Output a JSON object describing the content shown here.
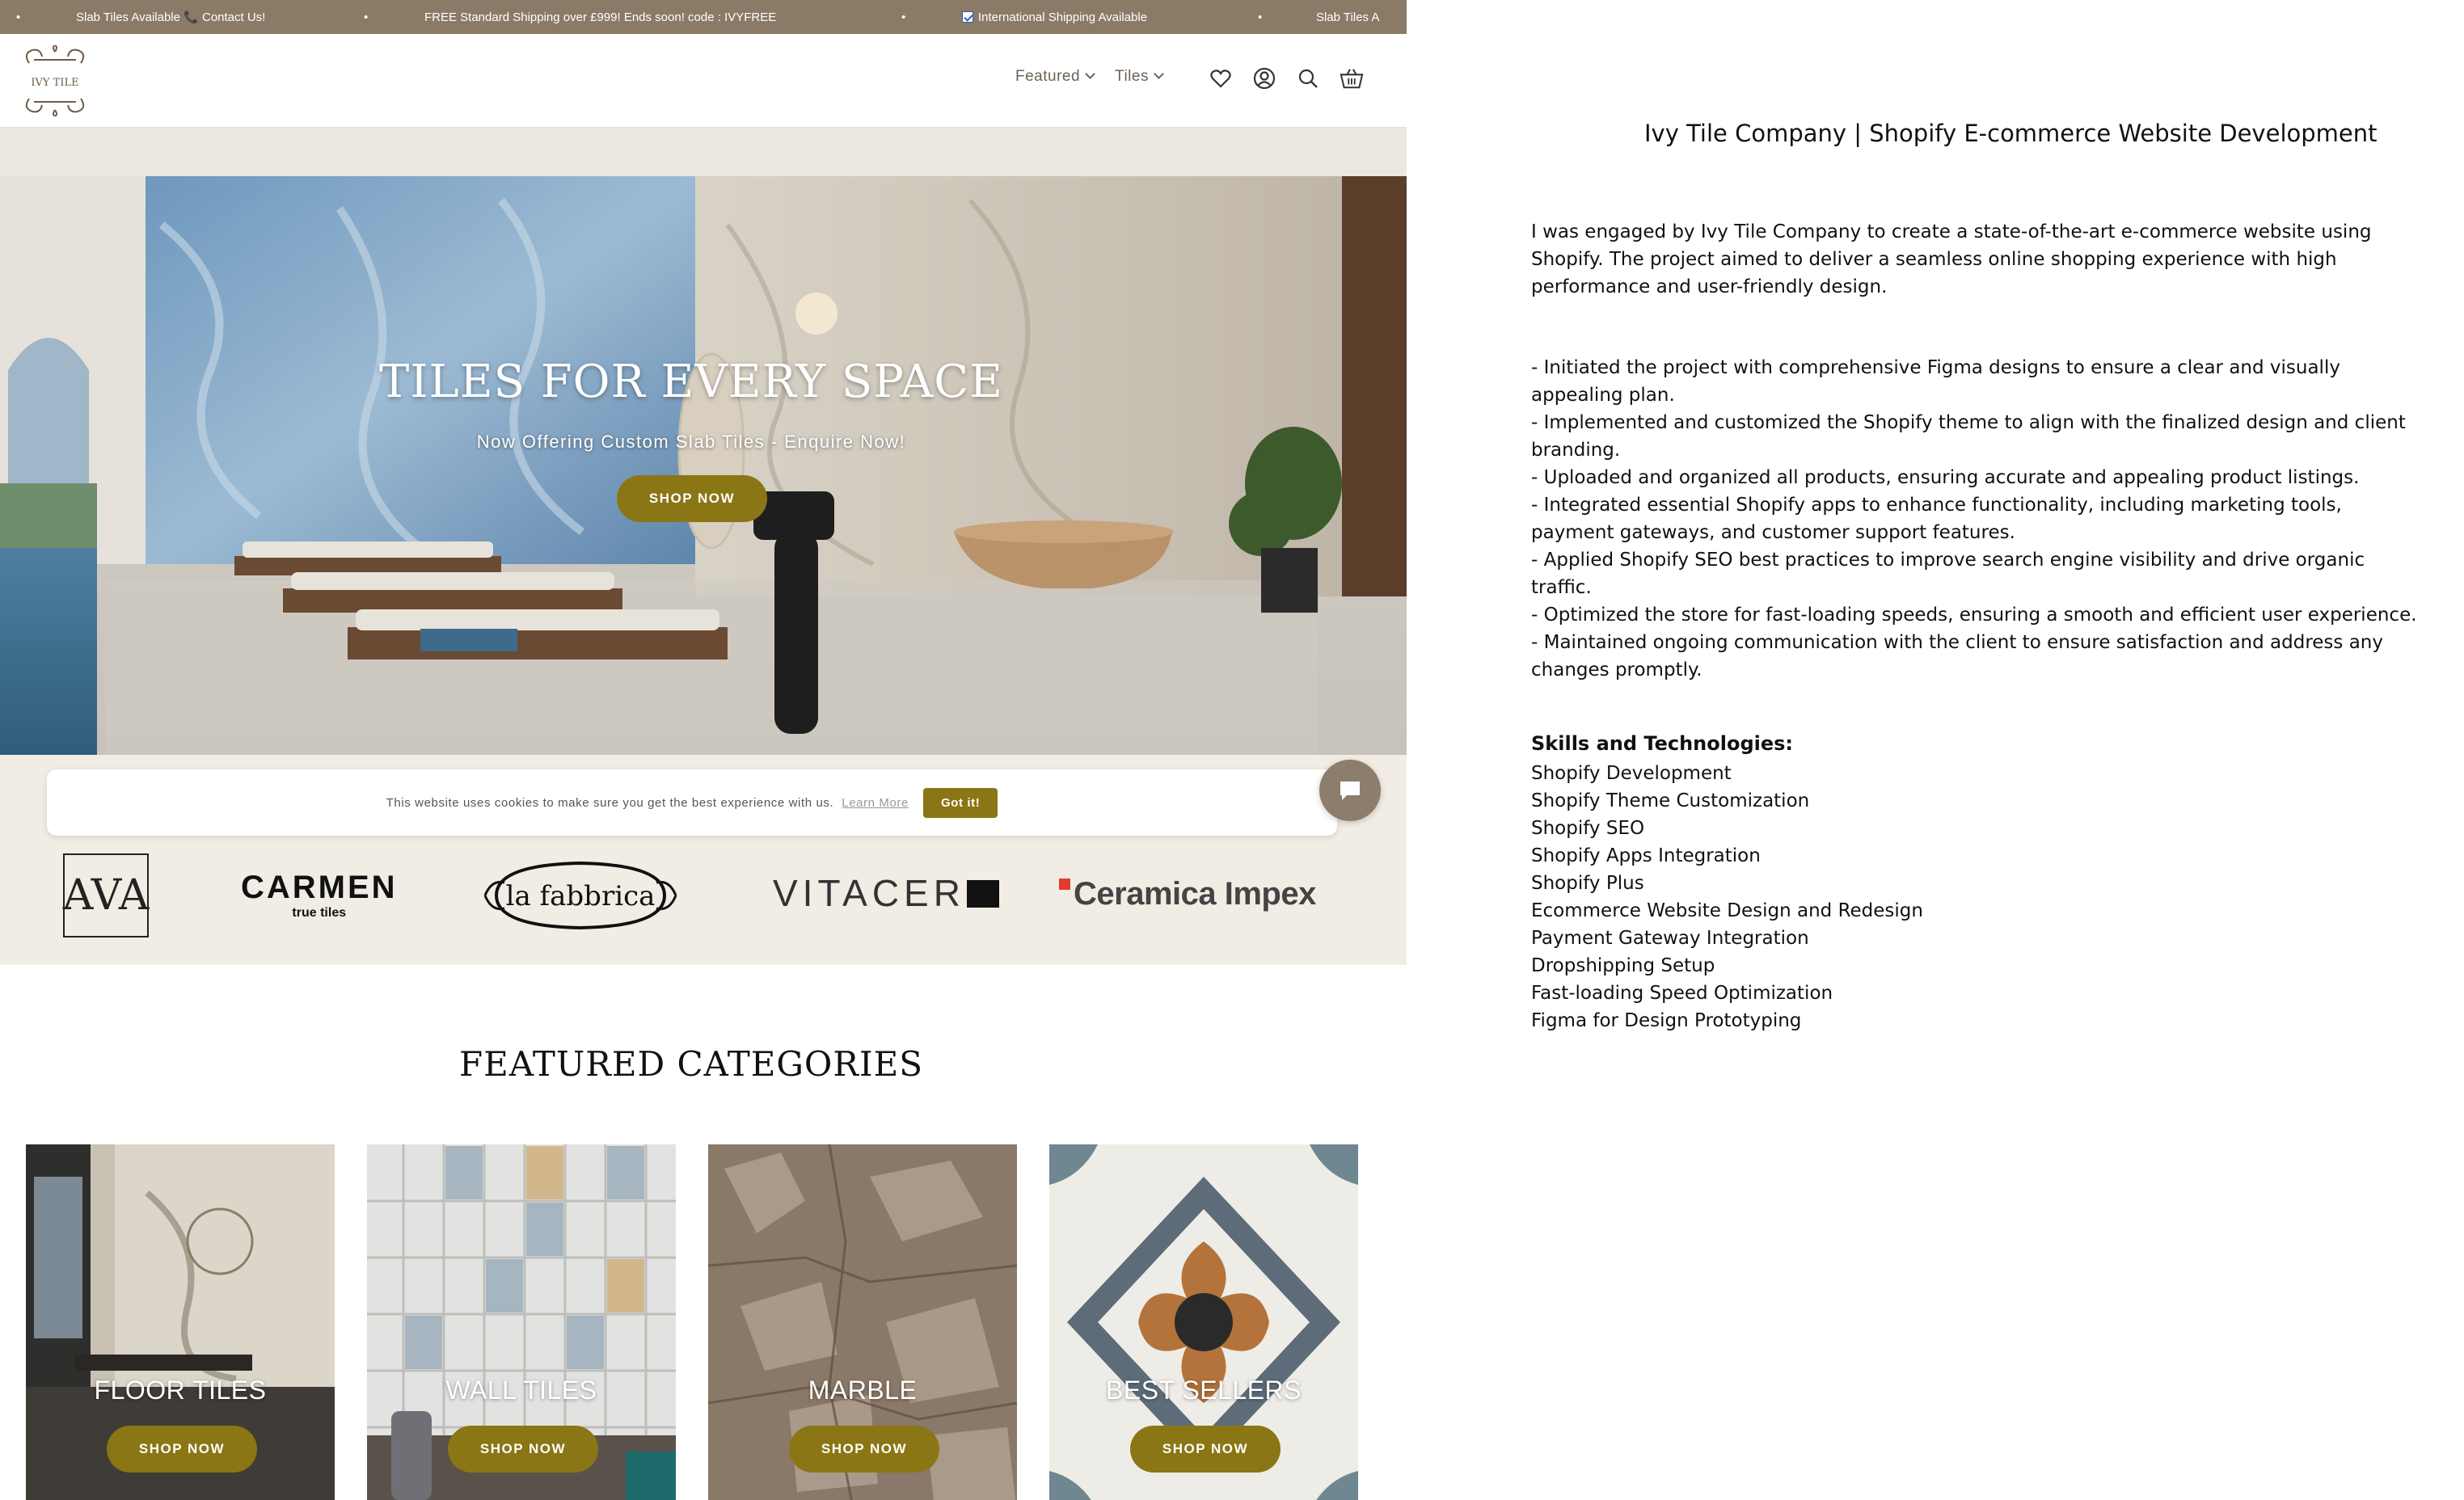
{
  "announcement": {
    "item1": "Slab Tiles Available 📞 Contact Us!",
    "item2": "FREE Standard Shipping over £999! Ends soon! code : IVYFREE",
    "item3": "International Shipping Available",
    "item4": "Slab Tiles A",
    "separator": "•"
  },
  "header": {
    "logo_text": "IVY TILE",
    "nav": [
      {
        "label": "Featured"
      },
      {
        "label": "Tiles"
      }
    ],
    "icons": [
      "heart-icon",
      "account-icon",
      "search-icon",
      "cart-icon"
    ]
  },
  "hero": {
    "title": "TILES FOR EVERY SPACE",
    "subtitle": "Now Offering Custom Slab Tiles - Enquire Now!",
    "button": "SHOP NOW"
  },
  "cookie": {
    "text": "This website uses cookies to make sure you get the best experience with us.",
    "learn_more": "Learn More",
    "button": "Got it!"
  },
  "brands": {
    "ava": "AVA",
    "carmen": "CARMEN",
    "carmen_sub": "true tiles",
    "fabbrica": "la fabbrica",
    "vitacer": "VITACER",
    "ceramica": "Ceramica Impex"
  },
  "featured": {
    "title": "FEATURED CATEGORIES",
    "cards": [
      {
        "label": "FLOOR TILES",
        "button": "SHOP NOW"
      },
      {
        "label": "WALL TILES",
        "button": "SHOP NOW"
      },
      {
        "label": "MARBLE",
        "button": "SHOP NOW"
      },
      {
        "label": "BEST SELLERS",
        "button": "SHOP NOW"
      }
    ]
  },
  "description": {
    "title": "Ivy Tile Company | Shopify E-commerce Website Development",
    "intro": "I was engaged by Ivy Tile Company to create a state-of-the-art e-commerce website using Shopify. The project aimed to deliver a seamless online shopping experience with high performance and user-friendly design.",
    "bullets": [
      "- Initiated the project with comprehensive Figma designs to ensure a clear and visually appealing plan.",
      "- Implemented and customized the Shopify theme to align with the finalized design and client branding.",
      "- Uploaded and organized all products, ensuring accurate and appealing product listings.",
      "- Integrated essential Shopify apps to enhance functionality, including marketing tools, payment gateways, and customer support features.",
      "- Applied Shopify SEO best practices to improve search engine visibility and drive organic traffic.",
      "- Optimized the store for fast-loading speeds, ensuring a smooth and efficient user experience.",
      "- Maintained ongoing communication with the client to ensure satisfaction and address any changes promptly."
    ],
    "skills_heading": "Skills and Technologies:",
    "skills": [
      "Shopify Development",
      "Shopify Theme Customization",
      "Shopify SEO",
      "Shopify Apps Integration",
      "Shopify Plus",
      "Ecommerce Website Design and Redesign",
      "Payment Gateway Integration",
      "Dropshipping Setup",
      "Fast-loading Speed Optimization",
      "Figma for Design Prototyping"
    ]
  },
  "colors": {
    "announcement_bg": "#8b7a66",
    "accent_gold": "#8a7614",
    "brand_strip_bg": "#f1ede4"
  }
}
